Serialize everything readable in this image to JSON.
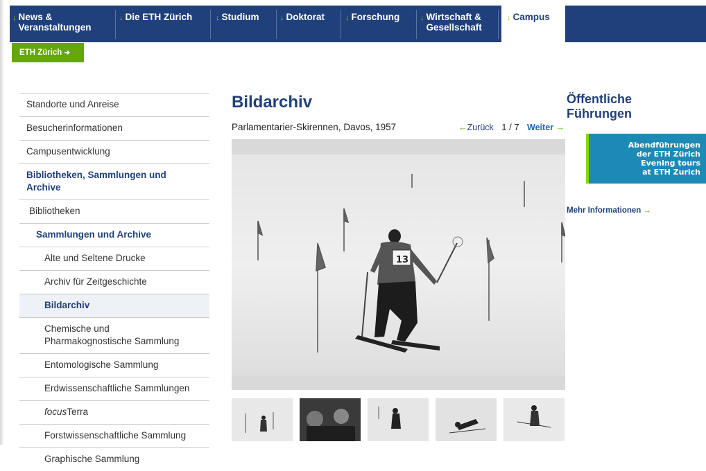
{
  "nav": {
    "items": [
      {
        "line1": "News &",
        "line2": "Veranstaltungen"
      },
      {
        "line1": "Die ETH Zürich",
        "line2": ""
      },
      {
        "line1": "Studium",
        "line2": ""
      },
      {
        "line1": "Doktorat",
        "line2": ""
      },
      {
        "line1": "Forschung",
        "line2": ""
      },
      {
        "line1": "Wirtschaft &",
        "line2": "Gesellschaft"
      },
      {
        "line1": "Campus",
        "line2": ""
      }
    ],
    "arrow": "↓"
  },
  "breadcrumb": {
    "label": "ETH Zürich",
    "arrow": "➔"
  },
  "sidebar": {
    "items": [
      {
        "label": "Standorte und Anreise"
      },
      {
        "label": "Besucherinformationen"
      },
      {
        "label": "Campusentwicklung"
      },
      {
        "label": "Bibliotheken, Sammlungen und Archive"
      },
      {
        "label": "Bibliotheken"
      },
      {
        "label": "Sammlungen und Archive"
      },
      {
        "label": "Alte und Seltene Drucke"
      },
      {
        "label": "Archiv für Zeitgeschichte"
      },
      {
        "label": "Bildarchiv"
      },
      {
        "label": "Chemische und Pharmakognostische Sammlung"
      },
      {
        "label": "Entomologische Sammlung"
      },
      {
        "label": "Erdwissenschaftliche Sammlungen"
      },
      {
        "label_italic": "focus",
        "label_rest": "Terra"
      },
      {
        "label": "Forstwissenschaftliche Sammlung"
      },
      {
        "label": "Graphische Sammlung"
      }
    ]
  },
  "main": {
    "title": "Bildarchiv",
    "caption": "Parlamentarier-Skirennen, Davos, 1957",
    "pager": {
      "prev_arrow": "←",
      "prev": "Zurück",
      "current": "1 / 7",
      "next": "Weiter",
      "next_arrow": "→"
    },
    "photo_bib": "13"
  },
  "right": {
    "title": "Öffentliche Führungen",
    "banner_lines": [
      "Abendführungen",
      "der ETH Zürich",
      "Evening tours",
      "at ETH Zurich"
    ],
    "more_label": "Mehr Informationen",
    "more_arrow": "→"
  },
  "colors": {
    "brand_blue": "#1f407a",
    "accent_green": "#64a70b",
    "banner_blue": "#1c8ab4"
  }
}
